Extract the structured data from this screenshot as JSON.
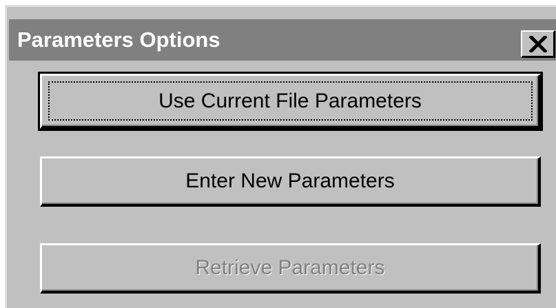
{
  "window": {
    "title": "Parameters Options",
    "close_glyph": "close-icon"
  },
  "buttons": {
    "use_current": {
      "label": "Use Current File Parameters",
      "default": true,
      "focused": true
    },
    "enter_new": {
      "label": "Enter New Parameters"
    },
    "retrieve": {
      "label": "Retrieve Parameters",
      "disabled": true
    }
  },
  "colors": {
    "face": "#c0c0c0",
    "titlebar": "#808080",
    "disabled_text": "#808080"
  }
}
